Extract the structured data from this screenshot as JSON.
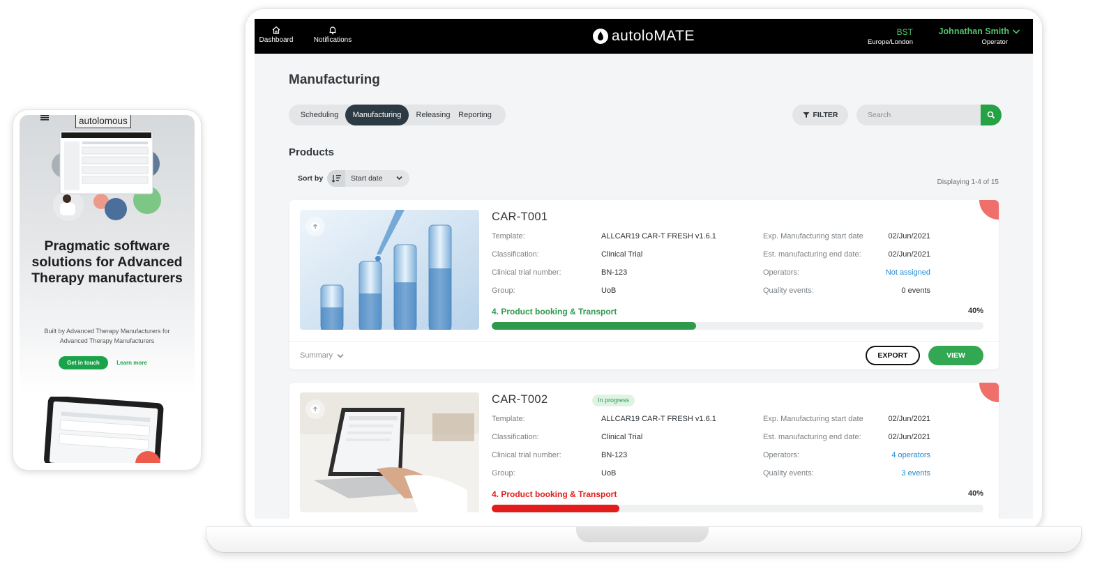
{
  "laptop": {
    "nav": {
      "dashboard_label": "Dashboard",
      "notifications_label": "Notifications"
    },
    "brand": {
      "name": "autoloMATE"
    },
    "timezone": {
      "code": "BST",
      "region": "Europe/London"
    },
    "user": {
      "name": "Johnathan Smith",
      "role": "Operator"
    },
    "page_title": "Manufacturing",
    "tabs": [
      {
        "label": "Scheduling",
        "active": false
      },
      {
        "label": "Manufacturing",
        "active": true
      },
      {
        "label": "Releasing",
        "active": false
      },
      {
        "label": "Reporting",
        "active": false
      }
    ],
    "filter_label": "FILTER",
    "search": {
      "placeholder": "Search",
      "value": ""
    },
    "section_title": "Products",
    "sort": {
      "label": "Sort by",
      "value": "Start date"
    },
    "displaying": "Displaying 1-4 of 15",
    "field_labels": {
      "template": "Template:",
      "classification": "Classification:",
      "trial_number": "Clinical trial number:",
      "group": "Group:",
      "start_date": "Exp. Manufacturing start date",
      "end_date": "Est. manufacturing end date:",
      "operators": "Operators:",
      "quality_events": "Quality events:"
    },
    "products": [
      {
        "id": "CAR-T001",
        "badge": "",
        "template": "ALLCAR19 CAR-T FRESH v1.6.1",
        "classification": "Clinical Trial",
        "trial_number": "BN-123",
        "group": "UoB",
        "start_date": "02/Jun/2021",
        "end_date": "02/Jun/2021",
        "operators": "Not assigned",
        "quality_events": "0 events",
        "stage": "4. Product booking & Transport",
        "stage_color": "#2e9a4c",
        "progress_label": "40%",
        "progress_fill": 0.415,
        "summary_label": "Summary",
        "export_label": "EXPORT",
        "view_label": "VIEW"
      },
      {
        "id": "CAR-T002",
        "badge": "In progress",
        "template": "ALLCAR19 CAR-T FRESH v1.6.1",
        "classification": "Clinical Trial",
        "trial_number": "BN-123",
        "group": "UoB",
        "start_date": "02/Jun/2021",
        "end_date": "02/Jun/2021",
        "operators": "4 operators",
        "quality_events": "3 events",
        "stage": "4. Product booking & Transport",
        "stage_color": "#e21b1b",
        "progress_label": "40%",
        "progress_fill": 0.26
      }
    ],
    "colors": {
      "accent_green": "#33a853",
      "alert_red": "#e21b1b",
      "link_blue": "#1d8bd8",
      "topbar": "#000000"
    }
  },
  "phone": {
    "logo": "autolomous",
    "headline": "Pragmatic software solutions for Advanced Therapy manufacturers",
    "subheadline": "Built by Advanced Therapy Manufacturers for Advanced Therapy Manufacturers",
    "cta_primary": "Get in touch",
    "cta_secondary": "Learn more"
  }
}
